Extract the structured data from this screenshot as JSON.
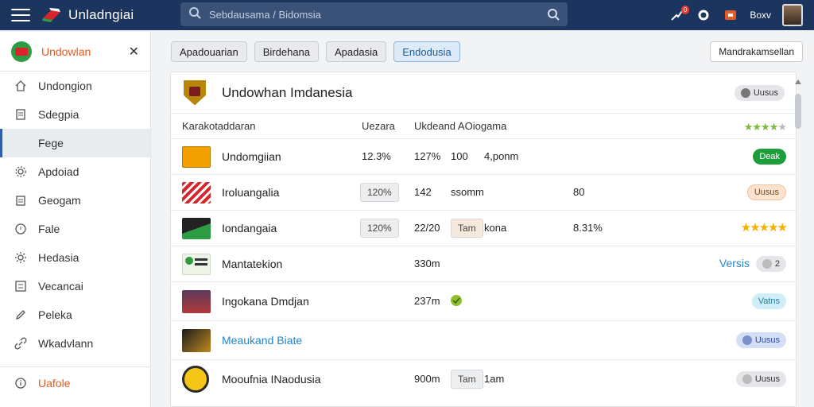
{
  "app": {
    "title": "Unladngiai"
  },
  "search": {
    "placeholder": "Sebdausama / Bidomsia"
  },
  "topbar": {
    "badge_count": "0",
    "user_label": "Boxv"
  },
  "sidebar": {
    "title": "Undowlan",
    "items": [
      {
        "label": "Undongion",
        "icon": "home-icon"
      },
      {
        "label": "Sdegpia",
        "icon": "document-icon"
      },
      {
        "label": "Fege",
        "icon": "folder-icon"
      },
      {
        "label": "Apdoiad",
        "icon": "settings-icon"
      },
      {
        "label": "Geogam",
        "icon": "clipboard-icon"
      },
      {
        "label": "Fale",
        "icon": "clock-icon"
      },
      {
        "label": "Hedasia",
        "icon": "gear-icon"
      },
      {
        "label": "Vecancai",
        "icon": "list-icon"
      },
      {
        "label": "Peleka",
        "icon": "edit-icon"
      },
      {
        "label": "Wkadvlann",
        "icon": "link-icon"
      }
    ],
    "bottom": {
      "label": "Uafole",
      "icon": "info-icon"
    }
  },
  "tabs": [
    {
      "label": "Apadouarian",
      "active": false
    },
    {
      "label": "Birdehana",
      "active": false
    },
    {
      "label": "Apadasia",
      "active": false
    },
    {
      "label": "Endodusia",
      "active": true
    }
  ],
  "top_action": {
    "label": "Mandrakamsellan"
  },
  "card": {
    "title": "Undowhan Imdanesia",
    "head_pill": "Uusus",
    "columns": {
      "c1": "Karakotaddaran",
      "c2": "Uezara",
      "c3": "Ukdeand AOiogama"
    },
    "rows": [
      {
        "name": "Undomgiian",
        "pct": "12.3%",
        "v1": "127%",
        "v2": "100",
        "v3": "4,ponm",
        "badge": "Deak",
        "badge_style": "green",
        "thumb_color": "#f2a000"
      },
      {
        "name": "Iroluangalia",
        "chip_left": "120%",
        "v1": "142",
        "v2": "ssomm",
        "v4": "80",
        "badge": "Uusus",
        "badge_style": "orange",
        "thumb_color": "#d9242b"
      },
      {
        "name": "Iondangaia",
        "chip_left": "120%",
        "v1": "22/20",
        "chip_mid": "Tam",
        "v3": "kona",
        "v4": "8.31%",
        "stars": "★★★★★",
        "thumb_color": "#222"
      },
      {
        "name": "Mantatekion",
        "v1": "330m",
        "link": "Versis",
        "badge": "2",
        "badge_style": "gray",
        "thumb_color": "#2e9c44"
      },
      {
        "name": "Ingokana Dmdjan",
        "v1": "237m",
        "badge": "Vatns",
        "badge_style": "cyan",
        "thumb_color": "#5c3a5a"
      },
      {
        "name": "Meaukand Biate",
        "name_link": true,
        "badge": "Uusus",
        "badge_style": "blue",
        "thumb_color": "#c08a20"
      },
      {
        "name": "Mooufnia INaodusia",
        "v1": "900m",
        "chip_mid": "Tam",
        "v3": "1am",
        "badge": "Uusus",
        "badge_style": "gray",
        "thumb_color": "#f5c518"
      }
    ]
  },
  "colors": {
    "topbar": "#1b355e",
    "accent": "#e65a1c",
    "link": "#2684c9"
  }
}
